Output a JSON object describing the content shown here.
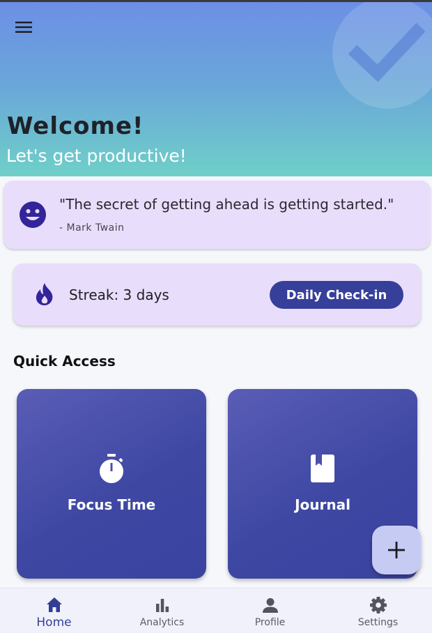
{
  "header": {
    "menu_icon": "hamburger-menu-icon",
    "decor_icon": "check-circle-icon",
    "title": "Welcome!",
    "subtitle": "Let's get productive!"
  },
  "quote": {
    "icon": "smiley-face-icon",
    "text": "\"The secret of getting ahead is getting started.\"",
    "author": "- Mark Twain"
  },
  "streak": {
    "icon": "fire-icon",
    "text": "Streak: 3 days",
    "button_label": "Daily Check-in"
  },
  "quick_access": {
    "title": "Quick Access",
    "tiles": [
      {
        "label": "Focus Time",
        "icon": "stopwatch-icon"
      },
      {
        "label": "Journal",
        "icon": "book-icon"
      }
    ]
  },
  "fab": {
    "icon": "plus-icon"
  },
  "bottom_nav": {
    "items": [
      {
        "label": "Home",
        "icon": "home-icon",
        "active": true
      },
      {
        "label": "Analytics",
        "icon": "bar-chart-icon",
        "active": false
      },
      {
        "label": "Profile",
        "icon": "person-icon",
        "active": false
      },
      {
        "label": "Settings",
        "icon": "gear-icon",
        "active": false
      }
    ]
  },
  "colors": {
    "primary": "#363f99",
    "card_background": "#e8defb",
    "tile_gradient_start": "#5a5db6",
    "tile_gradient_end": "#3a43a0",
    "fab_background": "#c6cbf4",
    "header_gradient_top": "#6c8fe6",
    "header_gradient_bottom": "#6fd0c8"
  }
}
